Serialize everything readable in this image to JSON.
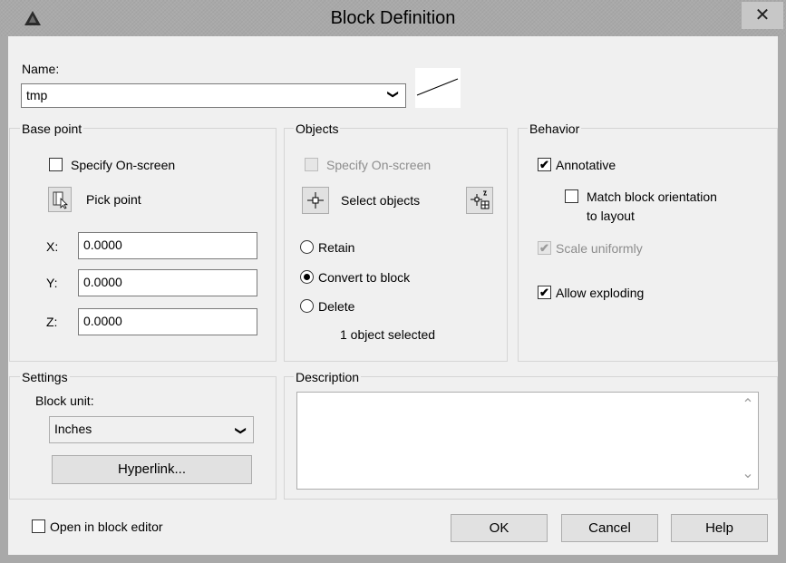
{
  "window": {
    "title": "Block Definition",
    "close_glyph": "✕",
    "app_icon": "autocad-logo-icon"
  },
  "name": {
    "label": "Name:",
    "value": "tmp",
    "dropdown_glyph": "❯"
  },
  "base_point": {
    "legend": "Base point",
    "specify_on_screen": {
      "label": "Specify On-screen",
      "checked": false
    },
    "pick_point_label": "Pick point",
    "x_label": "X:",
    "x_value": "0.0000",
    "y_label": "Y:",
    "y_value": "0.0000",
    "z_label": "Z:",
    "z_value": "0.0000"
  },
  "objects": {
    "legend": "Objects",
    "specify_on_screen": {
      "label": "Specify On-screen",
      "checked": false,
      "enabled": false
    },
    "select_objects_label": "Select objects",
    "retain_label": "Retain",
    "convert_label": "Convert to block",
    "delete_label": "Delete",
    "selected_option": "convert",
    "status": "1 object selected"
  },
  "behavior": {
    "legend": "Behavior",
    "annotative": {
      "label": "Annotative",
      "checked": true
    },
    "match_orientation": {
      "line1": "Match block orientation",
      "line2": "to layout",
      "checked": false
    },
    "scale_uniformly": {
      "label": "Scale uniformly",
      "checked": true,
      "enabled": false
    },
    "allow_exploding": {
      "label": "Allow exploding",
      "checked": true
    }
  },
  "settings": {
    "legend": "Settings",
    "block_unit_label": "Block unit:",
    "block_unit_value": "Inches",
    "hyperlink_label": "Hyperlink..."
  },
  "description": {
    "legend": "Description",
    "value": ""
  },
  "footer": {
    "open_in_editor": {
      "label": "Open in block editor",
      "checked": false
    },
    "ok_label": "OK",
    "cancel_label": "Cancel",
    "help_label": "Help"
  },
  "glyphs": {
    "check": "✔",
    "scroll_up": "⌃",
    "scroll_down": "⌄"
  }
}
